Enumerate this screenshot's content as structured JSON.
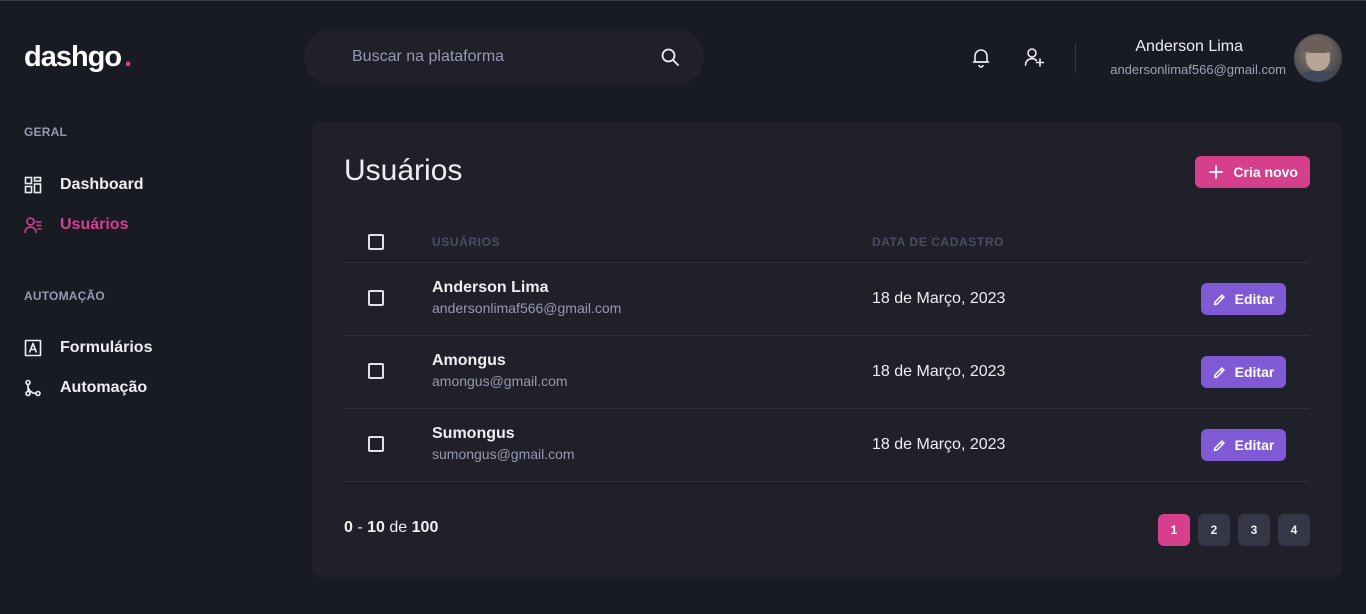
{
  "logo": {
    "text": "dashgo",
    "dot": "."
  },
  "search": {
    "placeholder": "Buscar na plataforma",
    "value": ""
  },
  "user": {
    "name": "Anderson Lima",
    "email": "andersonlimaf566@gmail.com"
  },
  "sidebar": {
    "sections": [
      {
        "title": "GERAL",
        "items": [
          {
            "label": "Dashboard"
          },
          {
            "label": "Usuários"
          }
        ]
      },
      {
        "title": "AUTOMAÇÃO",
        "items": [
          {
            "label": "Formulários"
          },
          {
            "label": "Automação"
          }
        ]
      }
    ],
    "active": "Usuários"
  },
  "main": {
    "title": "Usuários",
    "create_label": "Cria novo",
    "columns": [
      "USUÁRIOS",
      "DATA DE CADASTRO"
    ],
    "rows": [
      {
        "name": "Anderson Lima",
        "email": "andersonlimaf566@gmail.com",
        "date": "18 de Março, 2023",
        "edit_label": "Editar"
      },
      {
        "name": "Amongus",
        "email": "amongus@gmail.com",
        "date": "18 de Março, 2023",
        "edit_label": "Editar"
      },
      {
        "name": "Sumongus",
        "email": "sumongus@gmail.com",
        "date": "18 de Março, 2023",
        "edit_label": "Editar"
      }
    ],
    "pagination": {
      "from": "0",
      "dash": "-",
      "to": "10",
      "of_label": "de",
      "total": "100",
      "pages": [
        "1",
        "2",
        "3",
        "4"
      ],
      "current": "1"
    }
  },
  "colors": {
    "accent": "#d53f8c",
    "edit": "#805ad5",
    "background": "#181b23",
    "card": "#1f2029"
  },
  "icons": [
    "search-icon",
    "bell-icon",
    "user-plus-icon",
    "dashboard-icon",
    "users-icon",
    "form-icon",
    "automation-icon",
    "plus-icon",
    "pencil-icon"
  ]
}
